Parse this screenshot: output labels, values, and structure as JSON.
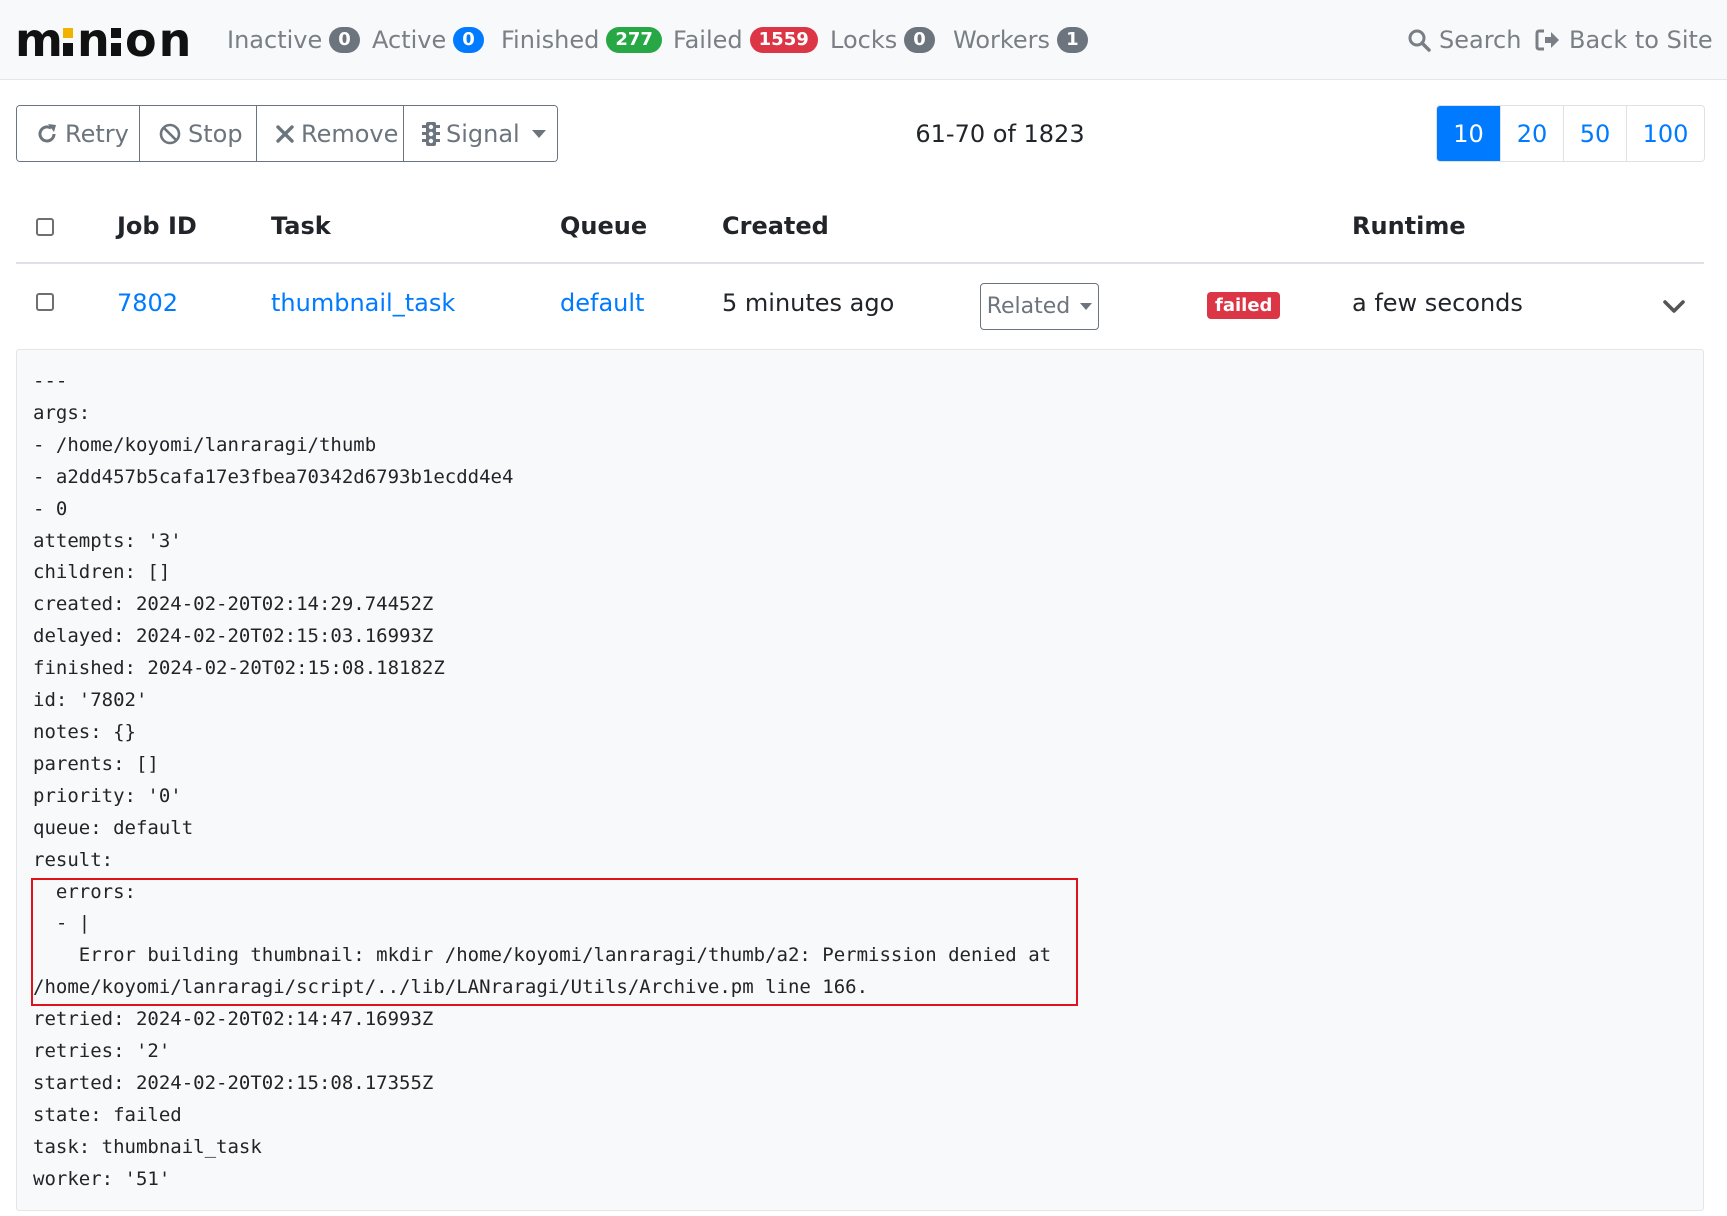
{
  "brand": {
    "name": "minion",
    "accent": "#f0b400"
  },
  "nav": {
    "items": [
      {
        "label": "Inactive",
        "count": "0",
        "color": "gray"
      },
      {
        "label": "Active",
        "count": "0",
        "color": "blue"
      },
      {
        "label": "Finished",
        "count": "277",
        "color": "green"
      },
      {
        "label": "Failed",
        "count": "1559",
        "color": "red"
      },
      {
        "label": "Locks",
        "count": "0",
        "color": "gray"
      },
      {
        "label": "Workers",
        "count": "1",
        "color": "gray"
      }
    ],
    "search_label": "Search",
    "back_label": "Back to Site"
  },
  "toolbar": {
    "retry_label": "Retry",
    "stop_label": "Stop",
    "remove_label": "Remove",
    "signal_label": "Signal"
  },
  "pager": {
    "range_text": "61-70 of 1823"
  },
  "limits": {
    "options": [
      "10",
      "20",
      "50",
      "100"
    ],
    "selected": "10"
  },
  "table": {
    "headers": {
      "job_id": "Job ID",
      "task": "Task",
      "queue": "Queue",
      "created": "Created",
      "runtime": "Runtime"
    },
    "row": {
      "job_id": "7802",
      "task": "thumbnail_task",
      "queue": "default",
      "created": "5 minutes ago",
      "related_label": "Related",
      "state": "failed",
      "runtime": "a few seconds"
    }
  },
  "detail": {
    "lines": [
      "---",
      "args:",
      "- /home/koyomi/lanraragi/thumb",
      "- a2dd457b5cafa17e3fbea70342d6793b1ecdd4e4",
      "- 0",
      "attempts: '3'",
      "children: []",
      "created: 2024-02-20T02:14:29.74452Z",
      "delayed: 2024-02-20T02:15:03.16993Z",
      "finished: 2024-02-20T02:15:08.18182Z",
      "id: '7802'",
      "notes: {}",
      "parents: []",
      "priority: '0'",
      "queue: default",
      "result:",
      "  errors:",
      "  - |",
      "    Error building thumbnail: mkdir /home/koyomi/lanraragi/thumb/a2: Permission denied at",
      "/home/koyomi/lanraragi/script/../lib/LANraragi/Utils/Archive.pm line 166.",
      "retried: 2024-02-20T02:14:47.16993Z",
      "retries: '2'",
      "started: 2024-02-20T02:15:08.17355Z",
      "state: failed",
      "task: thumbnail_task",
      "worker: '51'"
    ]
  }
}
